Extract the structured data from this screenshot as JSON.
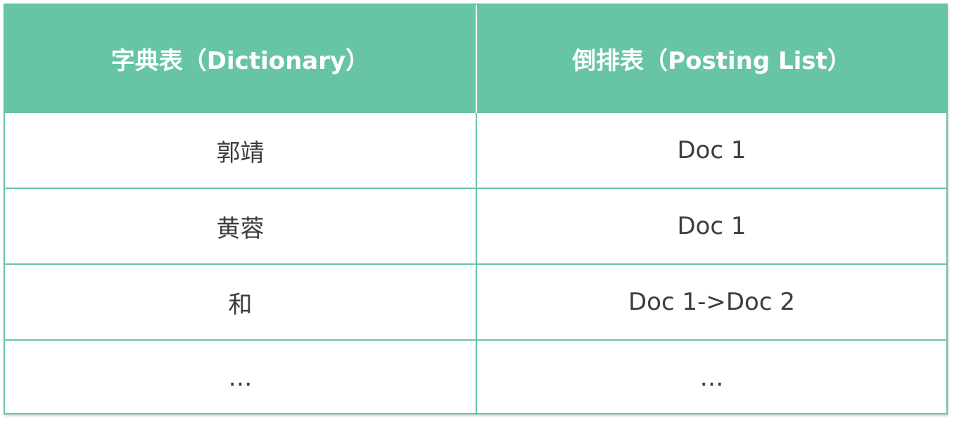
{
  "table": {
    "headers": [
      "字典表（Dictionary）",
      "倒排表（Posting List）"
    ],
    "rows": [
      [
        "郭靖",
        "Doc 1"
      ],
      [
        "黄蓉",
        "Doc 1"
      ],
      [
        "和",
        "Doc 1->Doc 2"
      ],
      [
        "…",
        "…"
      ]
    ]
  },
  "colors": {
    "header_bg": "#67c4a6",
    "header_text": "#ffffff",
    "border": "#67c4a6",
    "body_text": "#3d3d3d"
  }
}
